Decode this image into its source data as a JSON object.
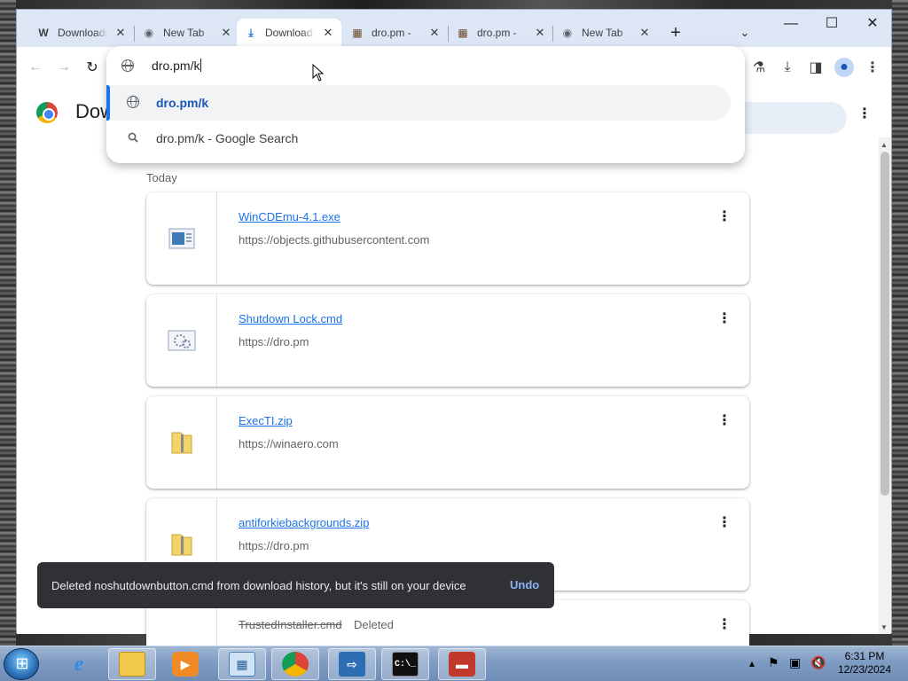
{
  "tabs": [
    {
      "label": "Downloads",
      "icon": "wikipedia-w-icon",
      "fav": "W"
    },
    {
      "label": "New Tab",
      "icon": "chrome-icon",
      "fav": "◉"
    },
    {
      "label": "Downloads",
      "icon": "download-icon",
      "fav": "⤓",
      "active": true
    },
    {
      "label": "dro.pm - ",
      "icon": "dro-pm-icon",
      "fav": "▦"
    },
    {
      "label": "dro.pm - ",
      "icon": "dro-pm-icon",
      "fav": "▦"
    },
    {
      "label": "New Tab",
      "icon": "chrome-icon",
      "fav": "◉"
    }
  ],
  "omnibox": {
    "input": "dro.pm/k",
    "suggestions": [
      {
        "text": "dro.pm/k",
        "icon": "globe-icon"
      },
      {
        "text": "dro.pm/k - Google Search",
        "icon": "search-icon"
      }
    ]
  },
  "page": {
    "title": "Dow",
    "section": "Today"
  },
  "downloads": [
    {
      "name": "WinCDEmu-4.1.exe",
      "url": "https://objects.githubusercontent.com",
      "icon": "exe-file-icon"
    },
    {
      "name": "Shutdown Lock.cmd",
      "url": "https://dro.pm",
      "icon": "cmd-file-icon"
    },
    {
      "name": "ExecTI.zip",
      "url": "https://winaero.com",
      "icon": "zip-folder-icon"
    },
    {
      "name": "antiforkiebackgrounds.zip",
      "url": "https://dro.pm",
      "icon": "zip-folder-icon"
    },
    {
      "name": "TrustedInstaller.cmd",
      "status": "Deleted",
      "icon": "cmd-file-icon"
    }
  ],
  "toast": {
    "message": "Deleted noshutdownbutton.cmd from download history, but it's still on your device",
    "action": "Undo"
  },
  "clock": {
    "time": "6:31 PM",
    "date": "12/23/2024"
  }
}
